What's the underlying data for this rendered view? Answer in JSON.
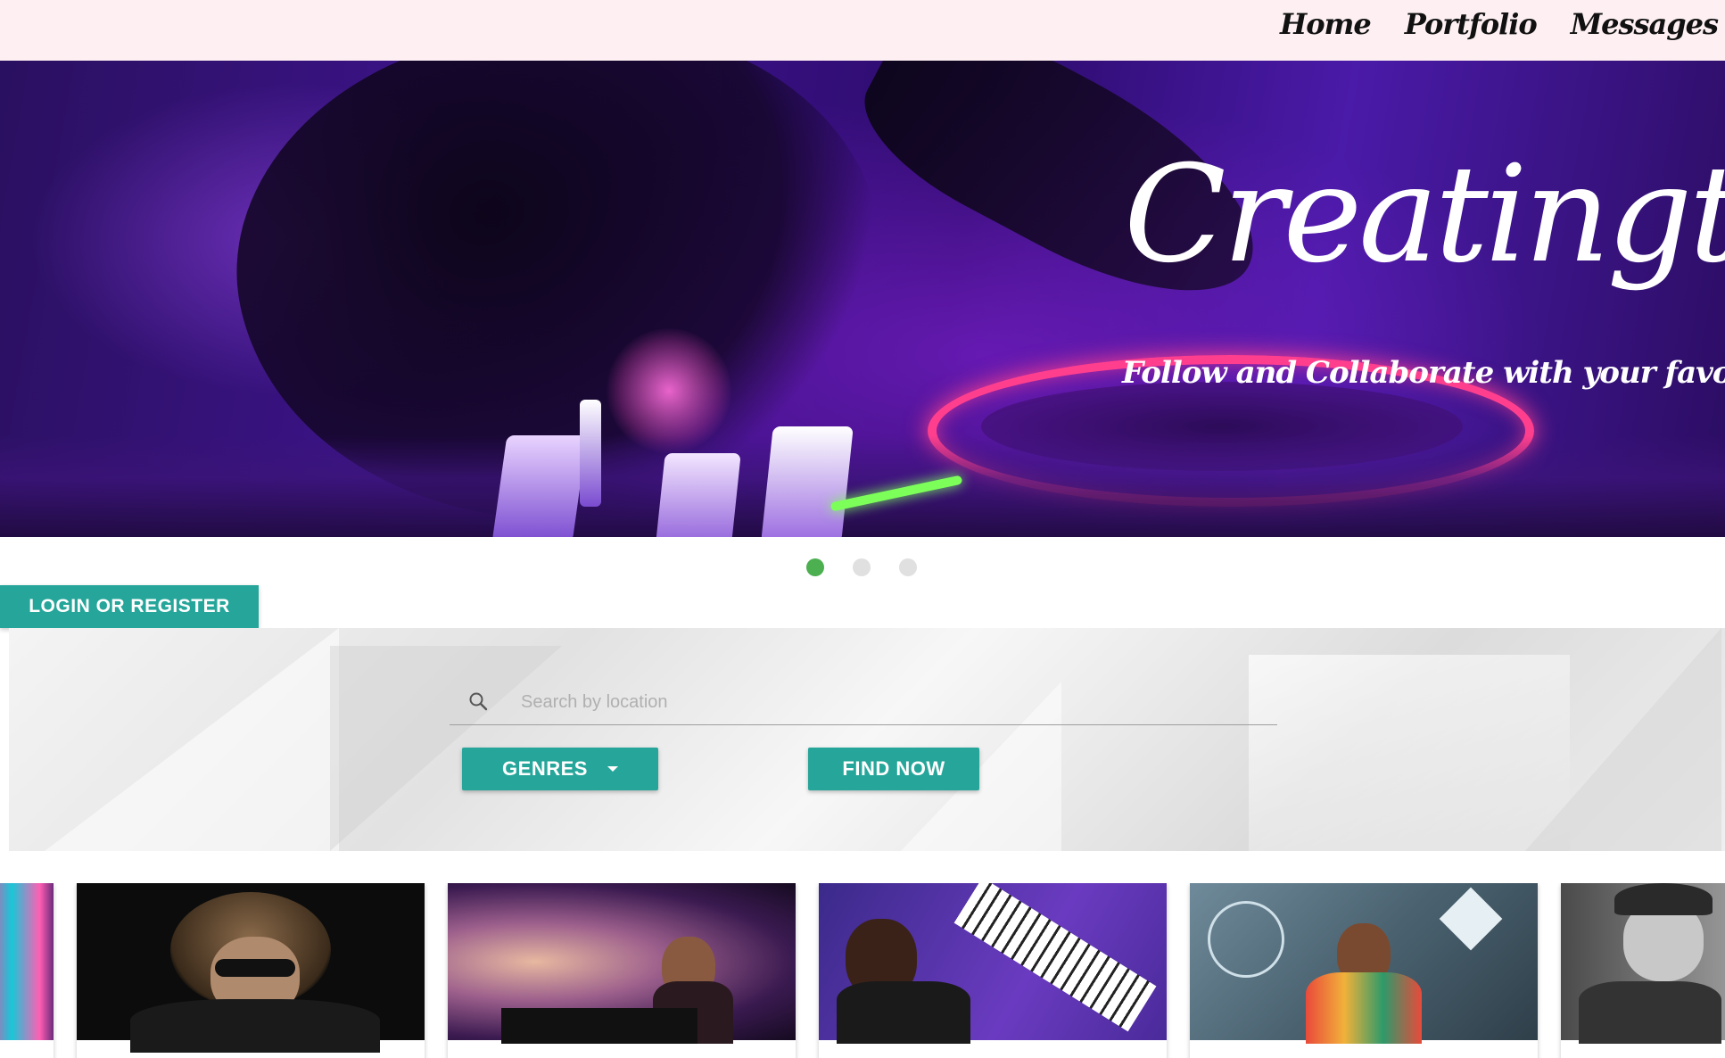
{
  "nav": {
    "links": [
      "Home",
      "Portfolio",
      "Messages"
    ]
  },
  "hero": {
    "title": "Creatington",
    "subtitle": "Follow and Collaborate with your favorite Artists"
  },
  "carousel": {
    "slide_count": 3,
    "active_index": 0
  },
  "auth": {
    "login_label": "LOGIN OR REGISTER"
  },
  "search": {
    "placeholder": "Search by location",
    "value": "",
    "genres_label": "GENRES",
    "find_label": "FIND NOW"
  },
  "artists": [
    {
      "image": "neon-city-photo"
    },
    {
      "image": "man-sunglasses-photo"
    },
    {
      "image": "dj-woman-photo"
    },
    {
      "image": "keytar-player-photo"
    },
    {
      "image": "dj-dancer-graffiti-photo"
    },
    {
      "image": "violinist-photo"
    }
  ],
  "colors": {
    "accent": "#26a69a",
    "nav_bg": "#fdeff2",
    "dot_active": "#4caf50",
    "dot_inactive": "#e0e0e0"
  }
}
